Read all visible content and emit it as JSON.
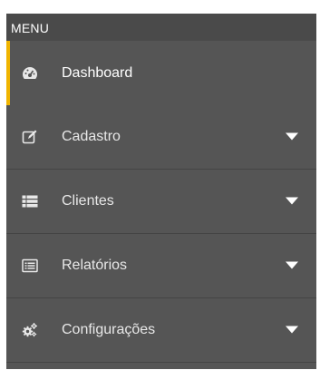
{
  "sidebar": {
    "header": "MENU",
    "items": [
      {
        "label": "Dashboard",
        "icon": "dashboard-icon",
        "active": true,
        "expandable": false
      },
      {
        "label": "Cadastro",
        "icon": "edit-icon",
        "active": false,
        "expandable": true
      },
      {
        "label": "Clientes",
        "icon": "list-icon",
        "active": false,
        "expandable": true
      },
      {
        "label": "Relatórios",
        "icon": "report-icon",
        "active": false,
        "expandable": true
      },
      {
        "label": "Configurações",
        "icon": "gears-icon",
        "active": false,
        "expandable": true
      }
    ]
  },
  "colors": {
    "sidebar_bg": "#555555",
    "header_bg": "#4a4a4a",
    "active_indicator": "#f0b400",
    "text": "#e8e8e8"
  }
}
